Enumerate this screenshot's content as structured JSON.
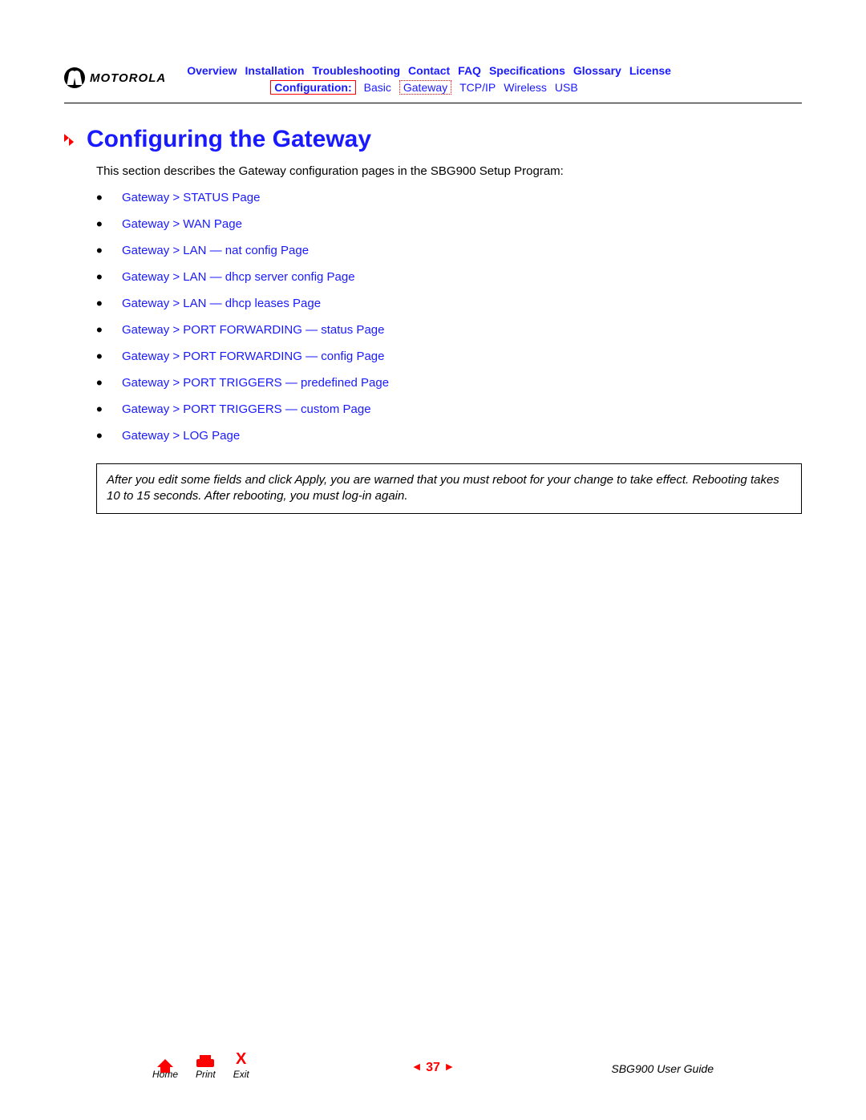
{
  "brand": {
    "name": "MOTOROLA"
  },
  "nav": {
    "row1": [
      "Overview",
      "Installation",
      "Troubleshooting",
      "Contact",
      "FAQ",
      "Specifications",
      "Glossary",
      "License"
    ],
    "row2_label": "Configuration:",
    "row2_items": [
      "Basic",
      "Gateway",
      "TCP/IP",
      "Wireless",
      "USB"
    ],
    "row2_active_index": 1
  },
  "title": "Configuring the Gateway",
  "intro": "This section describes the Gateway configuration pages in the SBG900 Setup Program:",
  "list": [
    "Gateway > STATUS Page",
    "Gateway > WAN Page",
    "Gateway > LAN — nat config Page",
    "Gateway > LAN — dhcp server config Page",
    "Gateway > LAN — dhcp leases Page",
    "Gateway > PORT FORWARDING — status Page",
    "Gateway > PORT FORWARDING — config Page",
    "Gateway > PORT TRIGGERS — predefined Page",
    "Gateway > PORT TRIGGERS — custom Page",
    "Gateway > LOG Page"
  ],
  "note": "After you edit some fields and click Apply, you are warned that you must reboot for your change to take effect. Rebooting takes 10 to 15 seconds. After rebooting, you must log-in again.",
  "footer": {
    "home": "Home",
    "print": "Print",
    "exit": "Exit",
    "exit_glyph": "X",
    "prev_glyph": "◄",
    "next_glyph": "►",
    "page_number": "37",
    "guide": "SBG900 User Guide"
  }
}
